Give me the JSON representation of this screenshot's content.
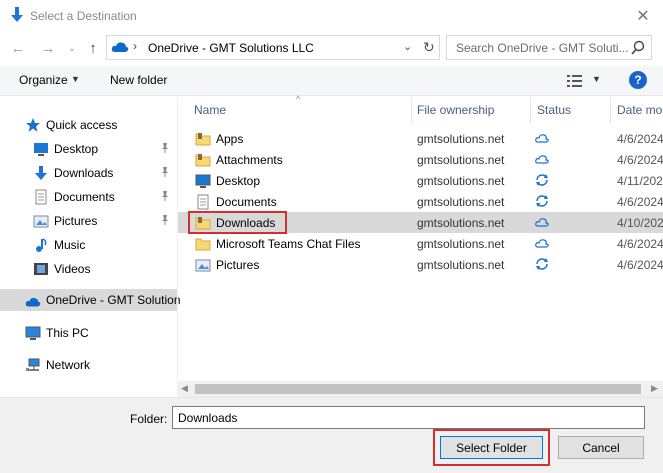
{
  "window": {
    "title": "Select a Destination"
  },
  "nav": {
    "path_root": "OneDrive - GMT Solutions LLC",
    "search_placeholder": "Search OneDrive - GMT Soluti..."
  },
  "toolbar": {
    "organize": "Organize",
    "new_folder": "New folder",
    "help": "?"
  },
  "sidebar": {
    "items": [
      {
        "label": "Quick access",
        "icon": "star-icon",
        "pinned": false
      },
      {
        "label": "Desktop",
        "icon": "desktop-icon",
        "pinned": true
      },
      {
        "label": "Downloads",
        "icon": "download-arrow-icon",
        "pinned": true
      },
      {
        "label": "Documents",
        "icon": "documents-icon",
        "pinned": true
      },
      {
        "label": "Pictures",
        "icon": "pictures-icon",
        "pinned": true
      },
      {
        "label": "Music",
        "icon": "music-note-icon",
        "pinned": false
      },
      {
        "label": "Videos",
        "icon": "videos-icon",
        "pinned": false
      },
      {
        "label": "OneDrive - GMT Solution",
        "icon": "onedrive-cloud-icon",
        "pinned": false,
        "selected": true
      },
      {
        "label": "This PC",
        "icon": "pc-icon",
        "pinned": false
      },
      {
        "label": "Network",
        "icon": "network-icon",
        "pinned": false
      }
    ]
  },
  "columns": {
    "name": "Name",
    "ownership": "File ownership",
    "status": "Status",
    "date": "Date mo"
  },
  "files": [
    {
      "name": "Apps",
      "owner": "gmtsolutions.net",
      "status": "cloud",
      "date": "4/6/2024",
      "icon": "folder-icon"
    },
    {
      "name": "Attachments",
      "owner": "gmtsolutions.net",
      "status": "cloud",
      "date": "4/6/2024",
      "icon": "folder-icon"
    },
    {
      "name": "Desktop",
      "owner": "gmtsolutions.net",
      "status": "sync",
      "date": "4/11/202",
      "icon": "desktop-folder-icon"
    },
    {
      "name": "Documents",
      "owner": "gmtsolutions.net",
      "status": "sync",
      "date": "4/6/2024",
      "icon": "documents-folder-icon"
    },
    {
      "name": "Downloads",
      "owner": "gmtsolutions.net",
      "status": "cloud",
      "date": "4/10/202",
      "icon": "folder-icon",
      "selected": true
    },
    {
      "name": "Microsoft Teams Chat Files",
      "owner": "gmtsolutions.net",
      "status": "cloud",
      "date": "4/6/2024",
      "icon": "folder-icon"
    },
    {
      "name": "Pictures",
      "owner": "gmtsolutions.net",
      "status": "sync",
      "date": "4/6/2024",
      "icon": "pictures-folder-icon"
    }
  ],
  "bottom": {
    "folder_label": "Folder:",
    "folder_value": "Downloads",
    "select_button": "Select Folder",
    "cancel_button": "Cancel"
  },
  "colors": {
    "accent": "#0078d7",
    "highlight": "#d32f2f",
    "selection": "#d9d9d9"
  }
}
